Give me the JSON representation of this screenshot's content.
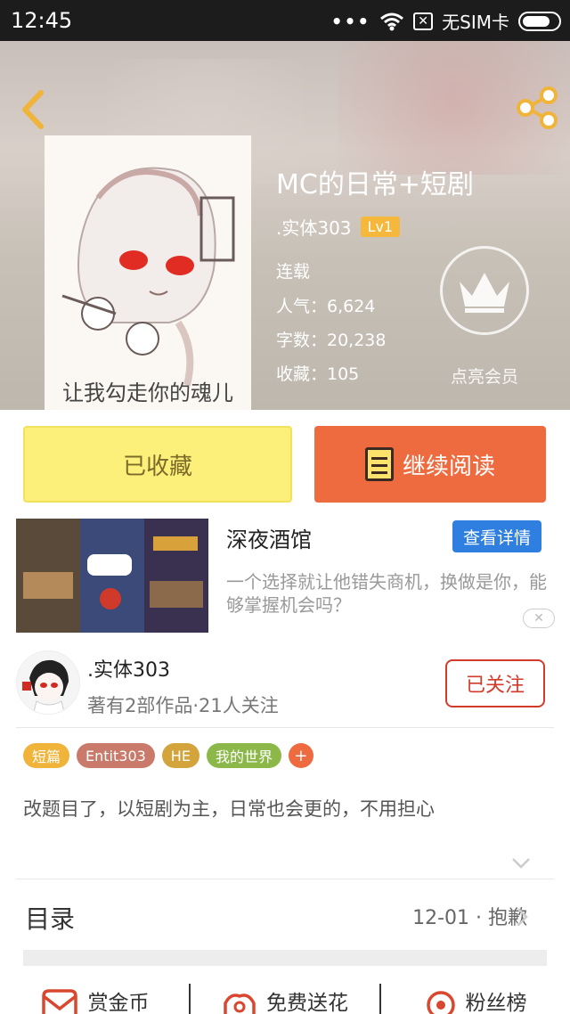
{
  "status_bar": {
    "time": "12:45",
    "dots": "•••",
    "sim_text": "无SIM卡"
  },
  "book": {
    "title": "MC的日常+短剧",
    "author": ".实体303",
    "level": "Lv1",
    "status": "连载",
    "popularity": "人气：6,624",
    "words": "字数：20,238",
    "favorites": "收藏：105",
    "vip_label": "点亮会员"
  },
  "cover": {
    "caption": "让我勾走你的魂儿"
  },
  "actions": {
    "favorited_label": "已收藏",
    "continue_label": "继续阅读"
  },
  "ad": {
    "title": "深夜酒馆",
    "button": "查看详情",
    "description": "一个选择就让他错失商机，换做是你，能够掌握机会吗？",
    "close": "✕"
  },
  "author_card": {
    "name": ".实体303",
    "stats": "著有2部作品·21人关注",
    "follow_label": "已关注"
  },
  "tags": [
    {
      "label": "短篇",
      "color": "#f0b43a"
    },
    {
      "label": "Entit303",
      "color": "#c97a6a"
    },
    {
      "label": "HE",
      "color": "#d3a33c"
    },
    {
      "label": "我的世界",
      "color": "#8cb84a"
    }
  ],
  "tag_add": "+",
  "intro": "改题目了，以短剧为主，日常也会更的，不用担心",
  "toc": {
    "label": "目录",
    "latest": "12-01 · 抱歉"
  },
  "bottom_bar": [
    {
      "label": "赏金币"
    },
    {
      "label": "免费送花"
    },
    {
      "label": "粉丝榜"
    }
  ],
  "colors": {
    "accent": "#ee6b3f",
    "fav_yellow": "#fdf07a",
    "follow_red": "#d23a2a",
    "ad_blue": "#2f7fe0"
  }
}
